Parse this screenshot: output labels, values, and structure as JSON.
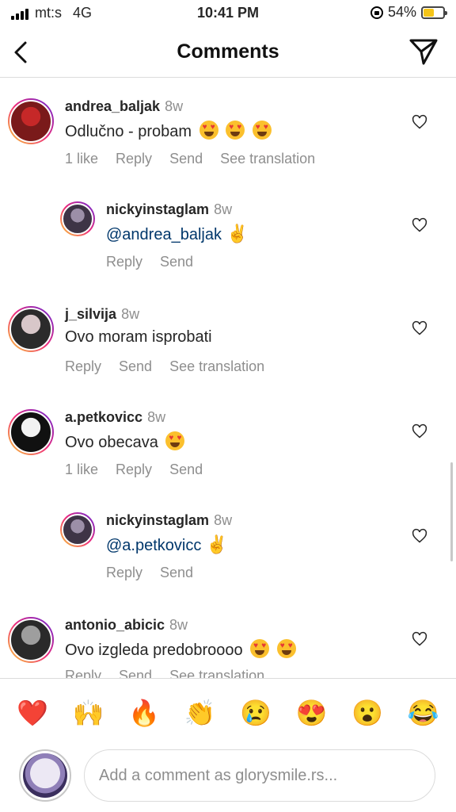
{
  "status": {
    "carrier": "mt:s",
    "network": "4G",
    "time": "10:41 PM",
    "battery": "54%",
    "battery_level": 0.54
  },
  "header": {
    "title": "Comments"
  },
  "comments": [
    {
      "username": "andrea_baljak",
      "time": "8w",
      "text": "Odlučno - probam",
      "emojis": 3,
      "actions": [
        "1 like",
        "Reply",
        "Send",
        "See translation"
      ],
      "avatar_colors": [
        "#c62828",
        "#7a1a1a"
      ]
    },
    {
      "username": "nickyinstaglam",
      "time": "8w",
      "mention": "@andrea_baljak",
      "actions": [
        "Reply",
        "Send"
      ],
      "avatar_colors": [
        "#9c8fa8",
        "#3e3446"
      ]
    },
    {
      "username": "j_silvija",
      "time": "8w",
      "text": "Ovo moram isprobati",
      "actions": [
        "Reply",
        "Send",
        "See translation"
      ],
      "avatar_colors": [
        "#d8c7c9",
        "#2b2b2b"
      ]
    },
    {
      "username": "a.petkovicc",
      "time": "8w",
      "text": "Ovo obecava",
      "emojis": 1,
      "actions": [
        "1 like",
        "Reply",
        "Send"
      ],
      "avatar_colors": [
        "#f2f2f2",
        "#111111"
      ]
    },
    {
      "username": "nickyinstaglam",
      "time": "8w",
      "mention": "@a.petkovicc",
      "actions": [
        "Reply",
        "Send"
      ],
      "avatar_colors": [
        "#9c8fa8",
        "#3e3446"
      ]
    },
    {
      "username": "antonio_abicic",
      "time": "8w",
      "text": "Ovo izgleda predobroooo",
      "emojis": 2,
      "actions": [
        "Reply",
        "Send",
        "See translation"
      ],
      "avatar_colors": [
        "#9e9e9e",
        "#2a2a2a"
      ]
    }
  ],
  "emoji_bar": [
    "❤️",
    "🙌",
    "🔥",
    "👏",
    "😢",
    "😍",
    "😮",
    "😂"
  ],
  "input": {
    "placeholder": "Add a comment as glorysmile.rs..."
  }
}
